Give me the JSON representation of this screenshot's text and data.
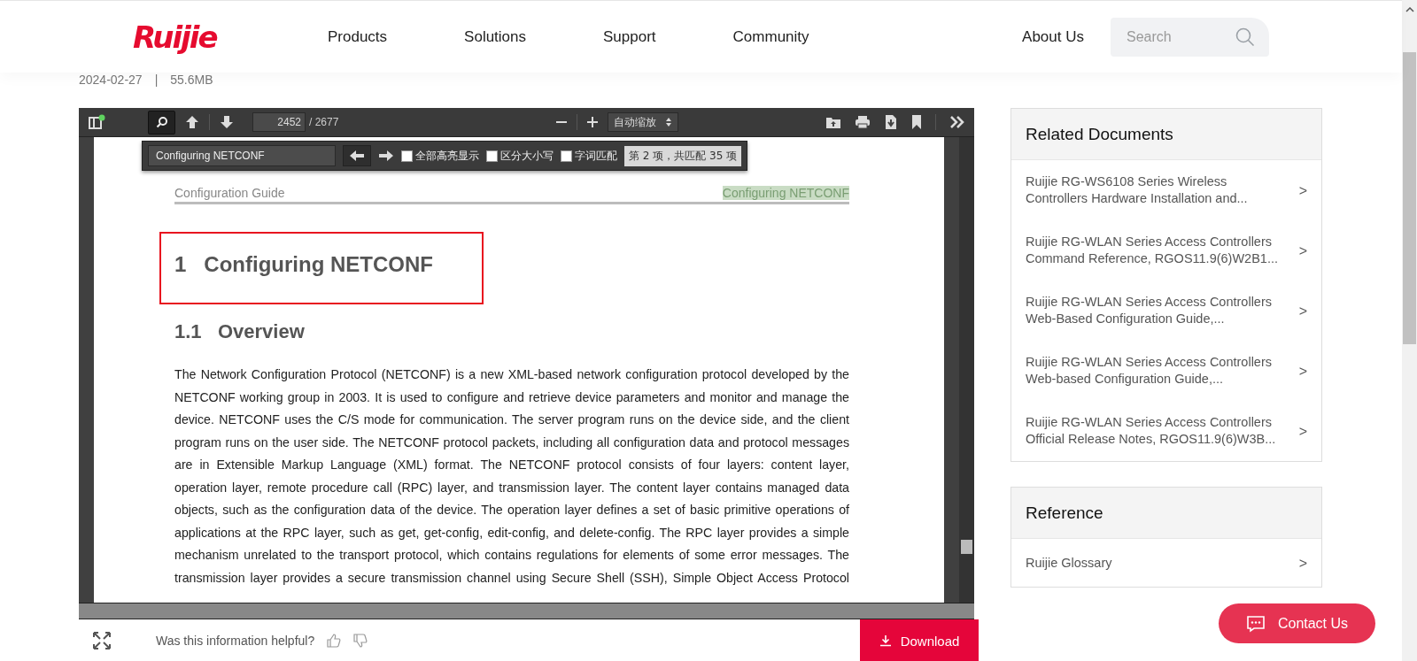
{
  "header": {
    "logo": "Ruijie",
    "nav": [
      {
        "label": "Products"
      },
      {
        "label": "Solutions"
      },
      {
        "label": "Support"
      },
      {
        "label": "Community"
      },
      {
        "label": "About Us"
      }
    ],
    "search": {
      "placeholder": "Search"
    }
  },
  "meta": {
    "date": "2024-02-27",
    "separator": "|",
    "size": "55.6MB"
  },
  "viewer": {
    "toolbar": {
      "search_active": true,
      "page": "2452",
      "page_count": "/ 2677",
      "zoom": "自动缩放"
    },
    "find_bar": {
      "query": "Configuring NETCONF",
      "options": [
        {
          "label": "全部高亮显示",
          "checked": false
        },
        {
          "label": "区分大小写",
          "checked": false
        },
        {
          "label": "字词匹配",
          "checked": false
        }
      ],
      "result": "第 2 项，共匹配 35 项"
    },
    "document": {
      "header_left": "Configuration Guide",
      "header_right": {
        "text": "Configuring NETCONF",
        "highlighted": true
      },
      "chapter_number": "1",
      "chapter_title": "Configuring NETCONF",
      "chapter_outlined": true,
      "section_number": "1.1",
      "section_title": "Overview",
      "paragraph": "The Network Configuration Protocol (NETCONF) is a new XML-based network configuration protocol developed by the NETCONF working group in 2003. It is used to configure and retrieve device parameters and monitor and manage the device. NETCONF uses the C/S mode for communication. The server program runs on the device side, and the client program runs on the user side. The NETCONF protocol packets, including all configuration data and protocol messages are in Extensible Markup Language (XML) format. The NETCONF protocol consists of four layers: content layer, operation layer, remote procedure call (RPC) layer, and transmission layer. The content layer contains managed data objects, such as the configuration data of the device. The operation layer defines a set of basic primitive operations of applications at the RPC layer, such as get, get-config, edit-config, and delete-config. The RPC layer provides a simple mechanism unrelated to the transport protocol, which contains regulations for elements of some error messages. The transmission layer provides a secure transmission channel using Secure Shell (SSH), Simple Object Access Protocol"
    }
  },
  "feedback": {
    "question": "Was this information helpful?",
    "download": "Download"
  },
  "related": {
    "title": "Related Documents",
    "items": [
      {
        "title": "Ruijie RG-WS6108 Series Wireless Controllers Hardware Installation and...",
        "arrow": ">"
      },
      {
        "title": "Ruijie RG-WLAN Series Access Controllers Command Reference, RGOS11.9(6)W2B1...",
        "arrow": ">"
      },
      {
        "title": "Ruijie RG-WLAN Series Access Controllers Web-Based Configuration Guide,...",
        "arrow": ">"
      },
      {
        "title": "Ruijie RG-WLAN Series Access Controllers Web-based Configuration Guide,...",
        "arrow": ">"
      },
      {
        "title": "Ruijie RG-WLAN Series Access Controllers Official Release Notes, RGOS11.9(6)W3B...",
        "arrow": ">"
      }
    ]
  },
  "reference": {
    "title": "Reference",
    "items": [
      {
        "title": "Ruijie Glossary",
        "arrow": ">"
      }
    ]
  },
  "contact": "Contact Us"
}
